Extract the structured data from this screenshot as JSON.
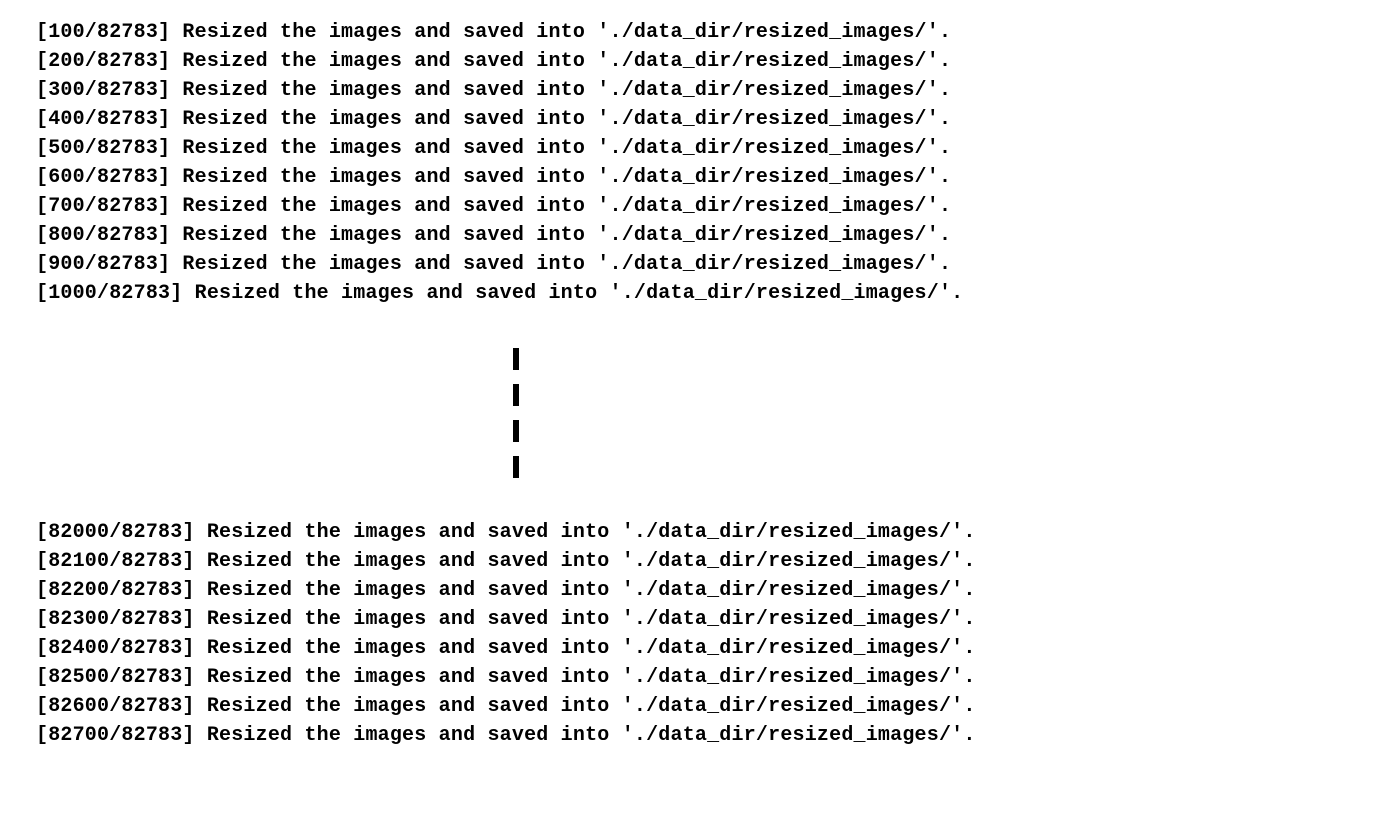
{
  "log": {
    "total": 82783,
    "message": "Resized the images and saved into './data_dir/resized_images/'.",
    "top_counts": [
      100,
      200,
      300,
      400,
      500,
      600,
      700,
      800,
      900,
      1000
    ],
    "bottom_counts": [
      82000,
      82100,
      82200,
      82300,
      82400,
      82500,
      82600,
      82700
    ]
  }
}
